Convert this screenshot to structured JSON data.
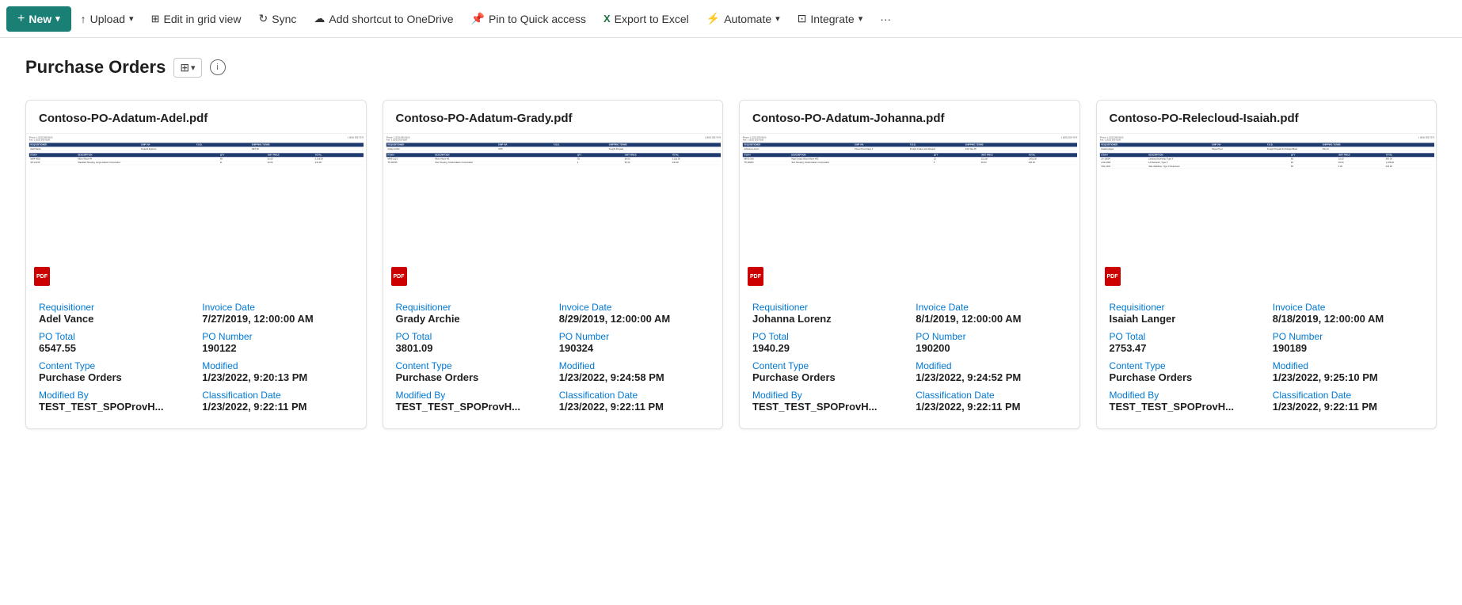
{
  "toolbar": {
    "new_label": "New",
    "upload_label": "Upload",
    "edit_grid_label": "Edit in grid view",
    "sync_label": "Sync",
    "add_shortcut_label": "Add shortcut to OneDrive",
    "pin_quick_label": "Pin to Quick access",
    "export_excel_label": "Export to Excel",
    "automate_label": "Automate",
    "integrate_label": "Integrate",
    "more_label": "···"
  },
  "page": {
    "title": "Purchase Orders",
    "view_icon": "grid-view-icon",
    "info_icon": "info-icon"
  },
  "cards": [
    {
      "filename": "Contoso-PO-Adatum-Adel.pdf",
      "requisitioner_label": "Requisitioner",
      "requisitioner": "Adel Vance",
      "invoice_date_label": "Invoice Date",
      "invoice_date": "7/27/2019, 12:00:00 AM",
      "po_total_label": "PO Total",
      "po_total": "6547.55",
      "po_number_label": "PO Number",
      "po_number": "190122",
      "content_type_label": "Content Type",
      "content_type": "Purchase Orders",
      "modified_label": "Modified",
      "modified": "1/23/2022, 9:20:13 PM",
      "modified_by_label": "Modified By",
      "modified_by": "TEST_TEST_SPOProvH...",
      "classification_date_label": "Classification Date",
      "classification_date": "1/23/2022, 9:22:11 PM",
      "doc_rows": [
        {
          "item": "MM4-4010",
          "desc": "Micro-Motor #4",
          "qty": "89",
          "unit": "62.00",
          "total": "5,518.00"
        },
        {
          "item": "SH-L2216",
          "desc": "Standard Housing, Large Adatum Corporation",
          "qty": "11",
          "unit": "22.00",
          "total": "242.00"
        }
      ],
      "ship_via": "Federal Express",
      "fob": "",
      "shipping_terms": "NET 60",
      "payment_terms": "PIA",
      "phone": "1 (513) 555-9100",
      "fax": "1 (513) 555-9100",
      "req_phone": "1 (800) 555-7676"
    },
    {
      "filename": "Contoso-PO-Adatum-Grady.pdf",
      "requisitioner_label": "Requisitioner",
      "requisitioner": "Grady Archie",
      "invoice_date_label": "Invoice Date",
      "invoice_date": "8/29/2019, 12:00:00 AM",
      "po_total_label": "PO Total",
      "po_total": "3801.09",
      "po_number_label": "PO Number",
      "po_number": "190324",
      "content_type_label": "Content Type",
      "content_type": "Purchase Orders",
      "modified_label": "Modified",
      "modified": "1/23/2022, 9:24:58 PM",
      "modified_by_label": "Modified By",
      "modified_by": "TEST_TEST_SPOProvH...",
      "classification_date_label": "Classification Date",
      "classification_date": "1/23/2022, 9:22:11 PM",
      "doc_rows": [
        {
          "item": "MM5-1121",
          "desc": "Micro-Motor #5",
          "qty": "35",
          "unit": "89.00",
          "total": "3,115.00"
        },
        {
          "item": "TH-S0155",
          "desc": "Test Housing, Small Adatum Corporation",
          "qty": "4",
          "unit": "55.30",
          "total": "240.00"
        }
      ],
      "ship_via": "UPS",
      "fob": "",
      "shipping_terms": "Freight Prepaid",
      "payment_terms": "NET 20"
    },
    {
      "filename": "Contoso-PO-Adatum-Johanna.pdf",
      "requisitioner_label": "Requisitioner",
      "requisitioner": "Johanna Lorenz",
      "invoice_date_label": "Invoice Date",
      "invoice_date": "8/1/2019, 12:00:00 AM",
      "po_total_label": "PO Total",
      "po_total": "1940.29",
      "po_number_label": "PO Number",
      "po_number": "190200",
      "content_type_label": "Content Type",
      "content_type": "Purchase Orders",
      "modified_label": "Modified",
      "modified": "1/23/2022, 9:24:52 PM",
      "modified_by_label": "Modified By",
      "modified_by": "TEST_TEST_SPOProvH...",
      "classification_date_label": "Classification Date",
      "classification_date": "1/23/2022, 9:22:11 PM",
      "doc_rows": [
        {
          "item": "MR32-006",
          "desc": "High Output Micro-Motor #32",
          "qty": "12",
          "unit": "121.00",
          "total": "1,452.00"
        },
        {
          "item": "TH-S8003",
          "desc": "Test Housing, Small Adatum Corporation",
          "qty": "5",
          "unit": "48.00",
          "total": "240.00"
        }
      ],
      "ship_via": "Parcel Post Class 4",
      "fob": "Freight Collect and Allowed",
      "shipping_terms": "2/10 Net 45",
      "payment_terms": ""
    },
    {
      "filename": "Contoso-PO-Relecloud-Isaiah.pdf",
      "requisitioner_label": "Requisitioner",
      "requisitioner": "Isaiah Langer",
      "invoice_date_label": "Invoice Date",
      "invoice_date": "8/18/2019, 12:00:00 AM",
      "po_total_label": "PO Total",
      "po_total": "2753.47",
      "po_number_label": "PO Number",
      "po_number": "190189",
      "content_type_label": "Content Type",
      "content_type": "Purchase Orders",
      "modified_label": "Modified",
      "modified": "1/23/2022, 9:25:10 PM",
      "modified_by_label": "Modified By",
      "modified_by": "TEST_TEST_SPOProvH...",
      "classification_date_label": "Classification Date",
      "classification_date": "1/23/2022, 9:22:11 PM",
      "doc_rows": [
        {
          "item": "LA-10004",
          "desc": "Landing Assembly, Type X",
          "qty": "66",
          "unit": "15.00",
          "total": "990.00"
        },
        {
          "item": "LAR-1004",
          "desc": "LA Retractor, Type X",
          "qty": "66",
          "unit": "18.00",
          "total": "1,188.00"
        },
        {
          "item": "SS2-1001",
          "desc": "Side Stabilizer, Type X Relecloud",
          "qty": "58",
          "unit": "4.00",
          "total": "232.00"
        }
      ],
      "ship_via": "Parcel Post",
      "fob": "Freight Prepaid & Charged Back",
      "shipping_terms": "Net 10",
      "payment_terms": ""
    }
  ]
}
